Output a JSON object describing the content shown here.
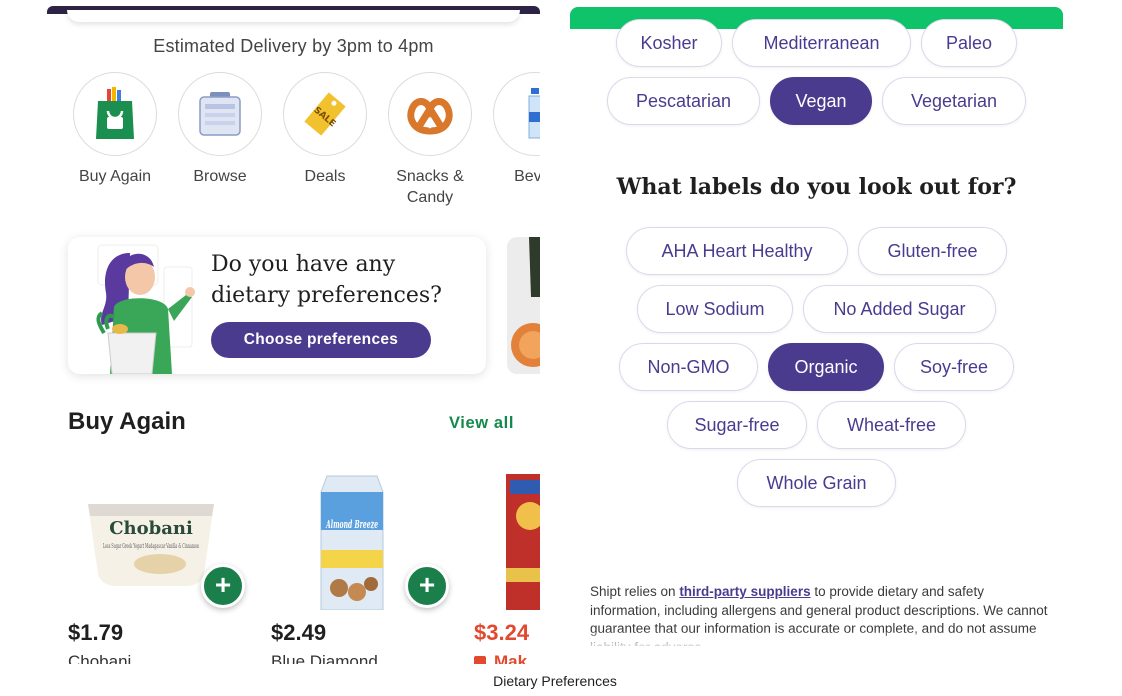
{
  "home": {
    "delivery_text": "Estimated Delivery by 3pm to 4pm",
    "categories": [
      {
        "label": "Buy Again",
        "icon": "shopping-bag-icon"
      },
      {
        "label": "Browse",
        "icon": "grocery-aisle-icon"
      },
      {
        "label": "Deals",
        "icon": "sale-tag-icon"
      },
      {
        "label": "Snacks &\nCandy",
        "icon": "pretzel-icon"
      },
      {
        "label": "Bever",
        "icon": "water-bottle-icon"
      }
    ],
    "promo": {
      "title": "Do you have any dietary preferences?",
      "button_label": "Choose preferences"
    },
    "buy_again": {
      "title": "Buy Again",
      "view_all_label": "View all",
      "products": [
        {
          "price": "$1.79",
          "name": "Chobani",
          "brand_text": "Chobani",
          "package_text": "Less Sugar Greek Yogurt Madagascar Vanilla & Cinnamon"
        },
        {
          "price": "$2.49",
          "name": "Blue Diamond",
          "brand_text": "Almond Breeze"
        },
        {
          "price": "$3.24",
          "name": "Mak",
          "deal": true
        }
      ]
    }
  },
  "preferences": {
    "diets": [
      {
        "label": "Kosher",
        "selected": false
      },
      {
        "label": "Mediterranean",
        "selected": false
      },
      {
        "label": "Paleo",
        "selected": false
      },
      {
        "label": "Pescatarian",
        "selected": false
      },
      {
        "label": "Vegan",
        "selected": true
      },
      {
        "label": "Vegetarian",
        "selected": false
      }
    ],
    "labels_title": "What labels do you look out for?",
    "labels": [
      {
        "label": "AHA Heart Healthy",
        "selected": false
      },
      {
        "label": "Gluten-free",
        "selected": false
      },
      {
        "label": "Low Sodium",
        "selected": false
      },
      {
        "label": "No Added Sugar",
        "selected": false
      },
      {
        "label": "Non-GMO",
        "selected": false
      },
      {
        "label": "Organic",
        "selected": true
      },
      {
        "label": "Soy-free",
        "selected": false
      },
      {
        "label": "Sugar-free",
        "selected": false
      },
      {
        "label": "Wheat-free",
        "selected": false
      },
      {
        "label": "Whole Grain",
        "selected": false
      }
    ],
    "disclaimer": {
      "prefix": "Shipt relies on ",
      "link": "third-party suppliers",
      "suffix": " to provide dietary and safety information, including allergens and general product descriptions. We cannot guarantee that our information is accurate or complete, and do not assume liability for adverse"
    }
  },
  "caption": "Dietary Preferences",
  "colors": {
    "brand_purple": "#4b3b8f",
    "brand_green": "#1a7f4a",
    "header_green": "#0fc36a",
    "deal_red": "#e2492f"
  }
}
